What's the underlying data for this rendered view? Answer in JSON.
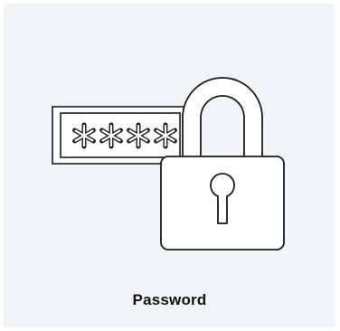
{
  "icon": {
    "name": "password-lock-icon",
    "field_mask_char": "*",
    "stroke_color": "#1a1a1a",
    "fill_color": "#ffffff",
    "background_color": "#f2f5f7"
  },
  "caption": {
    "text": "Password"
  }
}
